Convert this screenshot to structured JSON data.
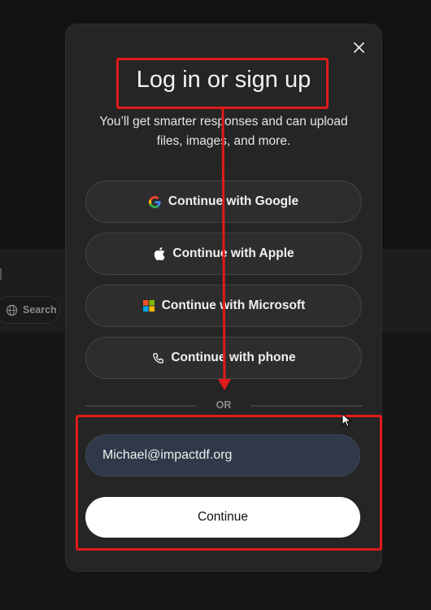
{
  "background": {
    "search_label": "Search"
  },
  "modal": {
    "title": "Log in or sign up",
    "subtitle": "You’ll get smarter responses and can upload files, images, and more.",
    "auth_buttons": [
      {
        "label": "Continue with Google",
        "icon": "google-icon"
      },
      {
        "label": "Continue with Apple",
        "icon": "apple-icon"
      },
      {
        "label": "Continue with Microsoft",
        "icon": "microsoft-icon"
      },
      {
        "label": "Continue with phone",
        "icon": "phone-icon"
      }
    ],
    "divider_text": "OR",
    "email_value": "Michael@impactdf.org",
    "continue_label": "Continue",
    "close_icon": "close-icon"
  },
  "colors": {
    "annotation": "#e11a1a",
    "modal_bg": "#252525",
    "email_field_bg": "#303949"
  }
}
